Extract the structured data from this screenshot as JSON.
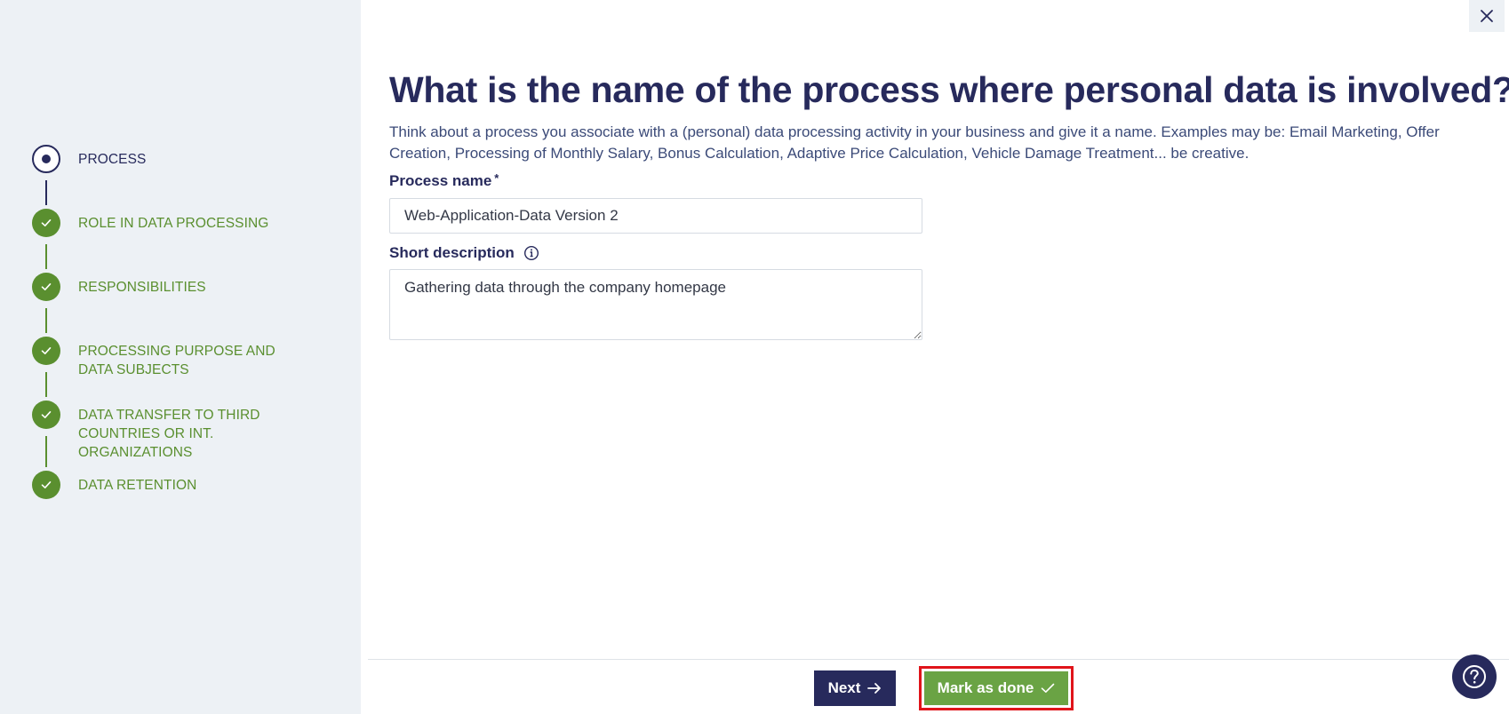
{
  "sidebar": {
    "steps": [
      {
        "label": "PROCESS",
        "state": "current"
      },
      {
        "label": "ROLE IN DATA PROCESSING",
        "state": "done"
      },
      {
        "label": "RESPONSIBILITIES",
        "state": "done"
      },
      {
        "label": "PROCESSING PURPOSE AND DATA SUBJECTS",
        "state": "done"
      },
      {
        "label": "DATA TRANSFER TO THIRD COUNTRIES OR INT. ORGANIZATIONS",
        "state": "done"
      },
      {
        "label": "DATA RETENTION",
        "state": "done"
      }
    ]
  },
  "main": {
    "title": "What is the name of the process where personal data is involved?",
    "intro": "Think about a process you associate with a (personal) data processing activity in your business and give it a name. Examples may be: Email Marketing, Offer Creation, Processing of Monthly Salary, Bonus Calculation, Adaptive Price Calculation, Vehicle Damage Treatment... be creative.",
    "process_name": {
      "label": "Process name",
      "required_mark": "*",
      "value": "Web-Application-Data Version 2"
    },
    "short_description": {
      "label": "Short description",
      "value": "Gathering data through the company homepage"
    }
  },
  "footer": {
    "next_label": "Next",
    "mark_done_label": "Mark as done"
  },
  "icons": {
    "close": "close-icon",
    "help": "question-mark-icon",
    "info": "info-icon",
    "check": "check-icon",
    "arrow": "arrow-right-icon"
  },
  "colors": {
    "primary": "#272a5c",
    "success": "#5a8f2f",
    "button_success": "#6aa344",
    "highlight": "#e0141a",
    "sidebar_bg": "#edf1f5"
  }
}
